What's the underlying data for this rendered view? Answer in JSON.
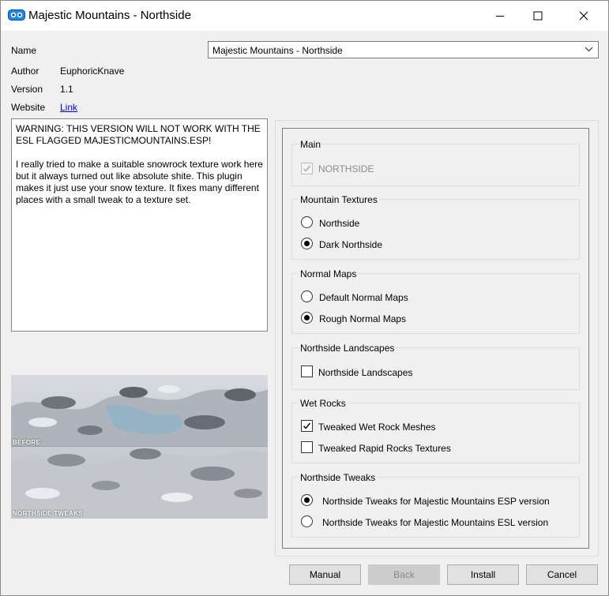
{
  "window": {
    "title": "Majestic Mountains - Northside",
    "icon": "mod-manager-icon"
  },
  "info": {
    "name_label": "Name",
    "name_value": "Majestic Mountains - Northside",
    "author_label": "Author",
    "author_value": "EuphoricKnave",
    "version_label": "Version",
    "version_value": "1.1",
    "website_label": "Website",
    "website_link": "Link"
  },
  "description": "WARNING: THIS VERSION WILL NOT WORK WITH THE ESL FLAGGED MAJESTICMOUNTAINS.ESP!\n\nI really tried to make a suitable snowrock texture work here but it always turned out like absolute shite. This plugin makes it just use your snow texture. It fixes many different places with a small tweak to a texture set.",
  "preview": {
    "caption_top": "BEFORE",
    "caption_bottom": "NORTHSIDE TWEAKS"
  },
  "groups": {
    "main": {
      "title": "Main",
      "options": [
        {
          "label": "NORTHSIDE",
          "checked": true,
          "disabled": true
        }
      ]
    },
    "mountain_textures": {
      "title": "Mountain Textures",
      "options": [
        {
          "label": "Northside",
          "selected": false
        },
        {
          "label": "Dark Northside",
          "selected": true
        }
      ]
    },
    "normal_maps": {
      "title": "Normal Maps",
      "options": [
        {
          "label": "Default Normal Maps",
          "selected": false
        },
        {
          "label": "Rough Normal Maps",
          "selected": true
        }
      ]
    },
    "northside_landscapes": {
      "title": "Northside Landscapes",
      "options": [
        {
          "label": "Northside Landscapes",
          "checked": false
        }
      ]
    },
    "wet_rocks": {
      "title": "Wet Rocks",
      "options": [
        {
          "label": "Tweaked Wet Rock Meshes",
          "checked": true
        },
        {
          "label": "Tweaked Rapid Rocks Textures",
          "checked": false
        }
      ]
    },
    "northside_tweaks": {
      "title": "Northside Tweaks",
      "options": [
        {
          "label": "Northside Tweaks for Majestic Mountains ESP version",
          "selected": true
        },
        {
          "label": "Northside Tweaks for Majestic Mountains ESL version",
          "selected": false
        }
      ]
    }
  },
  "buttons": {
    "manual": "Manual",
    "back": "Back",
    "install": "Install",
    "cancel": "Cancel"
  },
  "colors": {
    "accent_link": "#0000ee",
    "title_bar": "#ffffff",
    "dialog_bg": "#f0f0f0"
  }
}
